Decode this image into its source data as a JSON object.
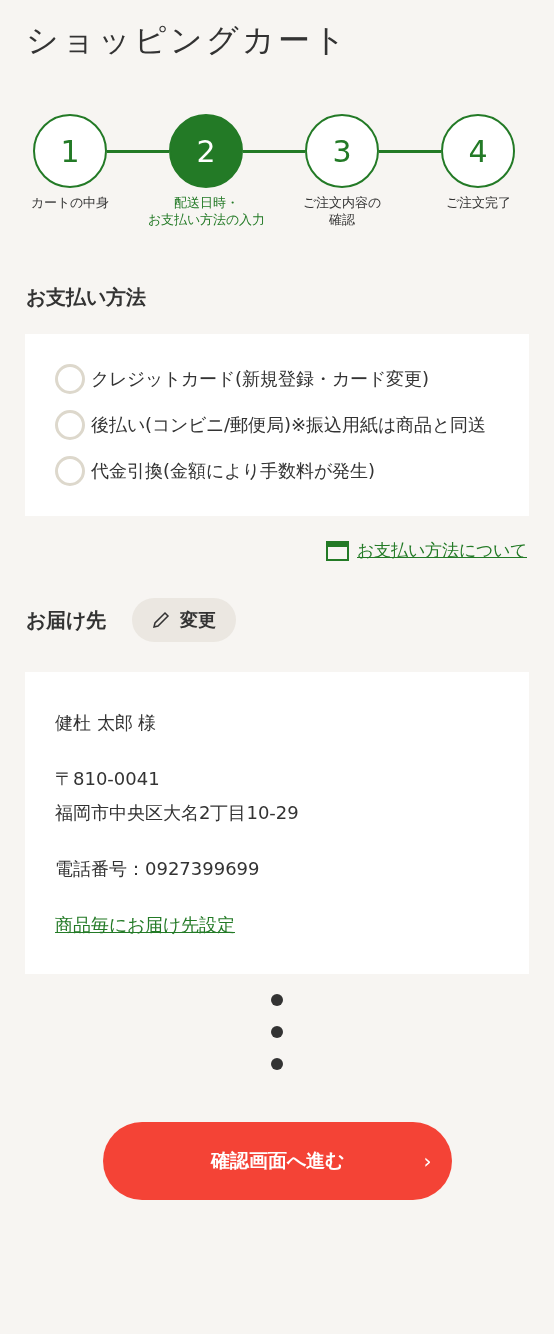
{
  "title": "ショッピングカート",
  "steps": [
    {
      "number": "1",
      "label": [
        "カートの中身"
      ],
      "selected": false
    },
    {
      "number": "2",
      "label": [
        "配送日時・",
        "お支払い方法の入力"
      ],
      "selected": true
    },
    {
      "number": "3",
      "label": [
        "ご注文内容の",
        "確認"
      ],
      "selected": false
    },
    {
      "number": "4",
      "label": [
        "ご注文完了"
      ],
      "selected": false
    }
  ],
  "payment": {
    "heading": "お支払い方法",
    "options": [
      {
        "label": "クレジットカード(新規登録・カード変更)",
        "selected": false
      },
      {
        "label": "後払い(コンビニ/郵便局)※振込用紙は商品と同送",
        "selected": false
      },
      {
        "label": "代金引換(金額により手数料が発生)",
        "selected": false
      }
    ],
    "link": "お支払い方法について"
  },
  "delivery": {
    "heading": "お届け先",
    "change_button": "変更",
    "name": "健杜 太郎 様",
    "postal": "〒810-0041",
    "address": "福岡市中央区大名2丁目10-29",
    "phone": "電話番号：0927399699",
    "link": "商品毎にお届け先設定"
  },
  "submit": {
    "label": "確認画面へ進む",
    "arrow": "›"
  }
}
